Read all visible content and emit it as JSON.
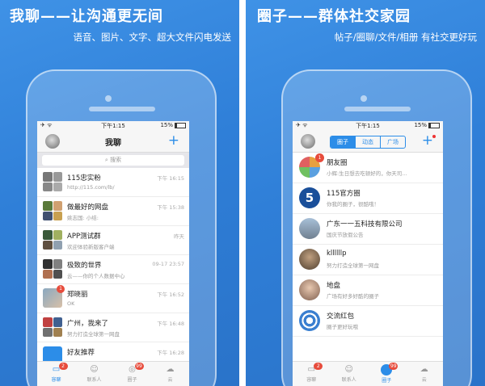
{
  "left_panel": {
    "headline": "我聊——让沟通更无间",
    "subline": "语音、图片、文字、超大文件闪电发送",
    "status": {
      "time": "下午1:15",
      "battery": "15%"
    },
    "nav_title": "我聊",
    "search_placeholder": "搜索",
    "rows": [
      {
        "name": "115忠实粉",
        "sub": "http://115.com/lb/",
        "time": "下午 16:15"
      },
      {
        "name": "做最好的网盘",
        "sub": "姚志国: 小结:",
        "time": "下午 15:38"
      },
      {
        "name": "APP测试群",
        "sub": "欢迎体验新版客户端",
        "time": "昨天"
      },
      {
        "name": "极致的世界",
        "sub": "云——你的个人数据中心",
        "time": "09-17 23:57"
      },
      {
        "name": "郑晓丽",
        "sub": "OK",
        "time": "下午 16:52",
        "badge": "1"
      },
      {
        "name": "广州，我来了",
        "sub": "努力打造全球第一网盘",
        "time": "下午 16:48"
      },
      {
        "name": "好友推荐",
        "sub": "",
        "time": "下午 16:28"
      }
    ],
    "tabs": [
      {
        "label": "容聊",
        "badge": "2",
        "icon": "chat-icon"
      },
      {
        "label": "联系人",
        "badge": "",
        "icon": "contacts-icon"
      },
      {
        "label": "圈子",
        "badge": "99",
        "icon": "circle-icon"
      },
      {
        "label": "云",
        "badge": "",
        "icon": "cloud-icon"
      }
    ]
  },
  "right_panel": {
    "headline": "圈子——群体社交家园",
    "subline": "帖子/圈聊/文件/相册  有社交更好玩",
    "status": {
      "time": "下午1:15",
      "battery": "15%"
    },
    "segments": [
      "圈子",
      "动态",
      "广场"
    ],
    "rows": [
      {
        "name": "朋友圈",
        "sub": "小辉:生日想去吃顿好的，你天司...",
        "badge": "1"
      },
      {
        "name": "115官方圈",
        "sub": "你我的圈子，很酷哦！",
        "badge": ""
      },
      {
        "name": "广东一一五科技有限公司",
        "sub": "国庆节放假公告",
        "badge": ""
      },
      {
        "name": "kllllllp",
        "sub": "努力打造全球第一网盘",
        "badge": ""
      },
      {
        "name": "地盘",
        "sub": "广场有好多好酷的圈子",
        "badge": ""
      },
      {
        "name": "交流红包",
        "sub": "圈子更好玩哦",
        "badge": ""
      }
    ],
    "tabs": [
      {
        "label": "容聊",
        "badge": "2",
        "icon": "chat-icon"
      },
      {
        "label": "联系人",
        "badge": "",
        "icon": "contacts-icon"
      },
      {
        "label": "圈子",
        "badge": "99",
        "icon": "circle-icon"
      },
      {
        "label": "云",
        "badge": "",
        "icon": "cloud-icon"
      }
    ]
  },
  "colors": {
    "accent": "#2c8de8",
    "badge": "#e74c3c",
    "background": "#3a8be2"
  }
}
